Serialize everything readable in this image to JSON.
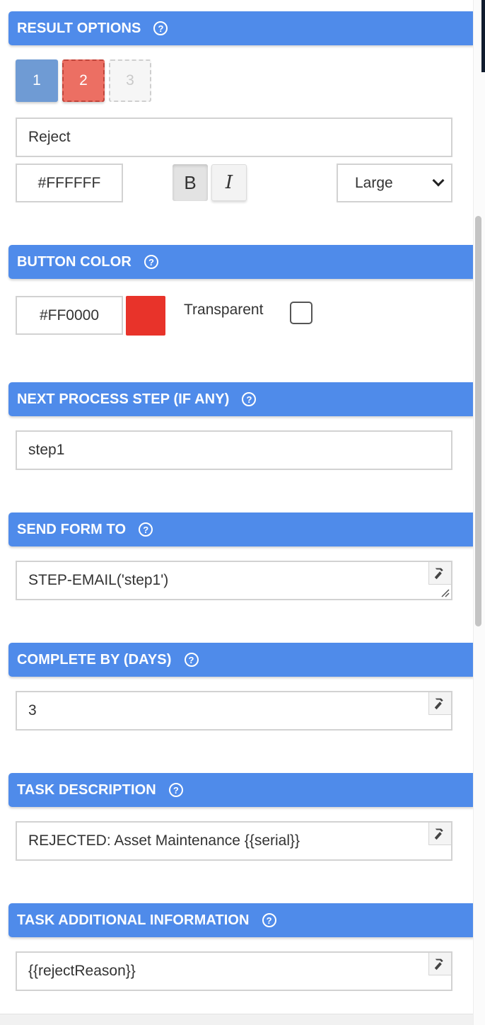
{
  "result_options": {
    "title": "RESULT OPTIONS",
    "result_buttons": [
      "1",
      "2",
      "3"
    ],
    "label_value": "Reject",
    "text_color": "#FFFFFF",
    "bold_label": "B",
    "italic_label": "I",
    "size_selected": "Large"
  },
  "button_color": {
    "title": "BUTTON COLOR",
    "color_value": "#FF0000",
    "swatch_color": "#e8332a",
    "transparent_label": "Transparent"
  },
  "next_step": {
    "title": "NEXT PROCESS STEP (IF ANY)",
    "value": "step1"
  },
  "send_form_to": {
    "title": "SEND FORM TO",
    "value": "STEP-EMAIL('step1')"
  },
  "complete_by": {
    "title": "COMPLETE BY (DAYS)",
    "value": "3"
  },
  "task_description": {
    "title": "TASK DESCRIPTION",
    "value": "REJECTED: Asset Maintenance {{serial}}"
  },
  "task_additional_info": {
    "title": "TASK ADDITIONAL INFORMATION",
    "value": "{{rejectReason}}"
  },
  "help_glyph": "?",
  "colors": {
    "header": "#4f8bea",
    "result_active": "#6f9bd4",
    "result_selected": "#ec6f63"
  }
}
